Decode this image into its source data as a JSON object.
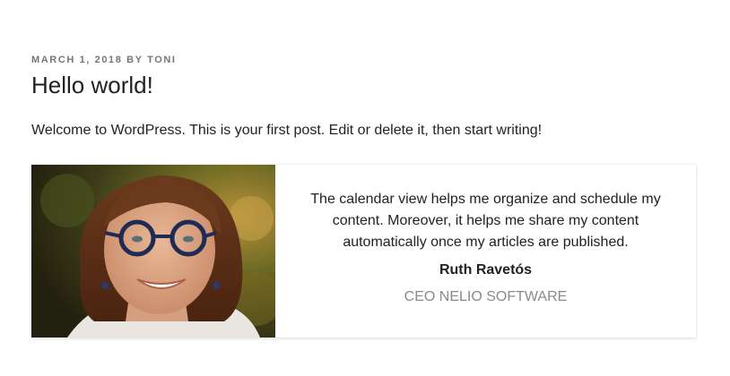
{
  "post": {
    "date": "March 1, 2018",
    "by_label": "by",
    "author": "Toni",
    "title": "Hello world!",
    "intro": "Welcome to WordPress. This is your first post. Edit or delete it, then start writing!"
  },
  "testimonial": {
    "quote": "The calendar view helps me organize and schedule my content. Moreover, it helps me share my content automatically once my articles are published.",
    "name": "Ruth Ravetós",
    "role": "CEO Nelio Software",
    "photo_icon": "portrait-photo"
  },
  "colors": {
    "text": "#222222",
    "meta": "#767676",
    "role": "#8a8a8a"
  }
}
